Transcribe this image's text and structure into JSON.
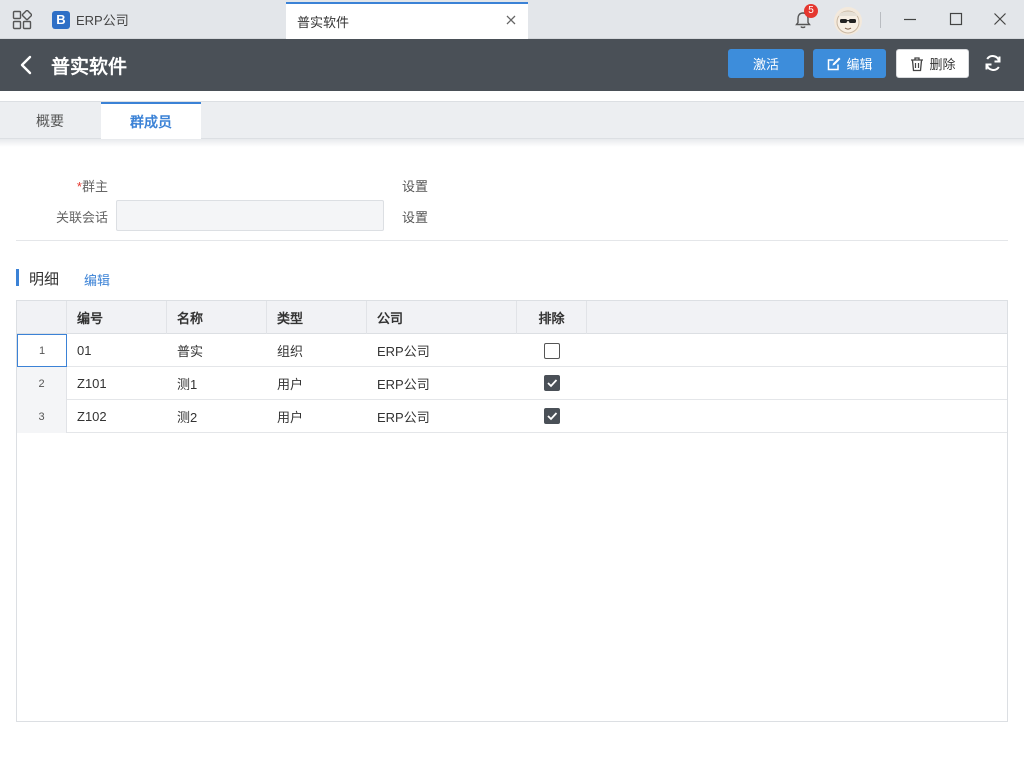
{
  "titlebar": {
    "app_tab_label": "ERP公司",
    "app_logo_glyph": "B",
    "active_tab_label": "普实软件",
    "notification_count": "5"
  },
  "header": {
    "title": "普实软件",
    "activate_label": "激活",
    "edit_label": "编辑",
    "delete_label": "删除"
  },
  "tabs": [
    {
      "label": "概要"
    },
    {
      "label": "群成员"
    }
  ],
  "form": {
    "owner_label": "群主",
    "owner_required_mark": "*",
    "owner_set_label": "设置",
    "session_label": "关联会话",
    "session_value": "",
    "session_set_label": "设置"
  },
  "detail": {
    "section_title": "明细",
    "edit_link": "编辑",
    "columns": [
      "编号",
      "名称",
      "类型",
      "公司",
      "排除"
    ],
    "rows": [
      {
        "num": "1",
        "code": "01",
        "name": "普实",
        "type": "组织",
        "company": "ERP公司",
        "excluded": false
      },
      {
        "num": "2",
        "code": "Z101",
        "name": "测1",
        "type": "用户",
        "company": "ERP公司",
        "excluded": true
      },
      {
        "num": "3",
        "code": "Z102",
        "name": "测2",
        "type": "用户",
        "company": "ERP公司",
        "excluded": true
      }
    ]
  },
  "colors": {
    "accent": "#3b82d6",
    "header_bg": "#4a5057",
    "badge": "#e5372f"
  }
}
